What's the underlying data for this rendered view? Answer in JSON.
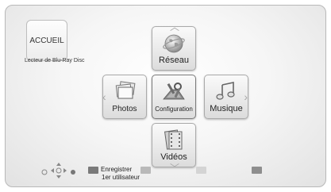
{
  "home": {
    "title": "ACCUEIL",
    "device_name": "Lecteur de Blu-Ray Disc"
  },
  "menu": {
    "items": [
      {
        "label": "Réseau",
        "icon": "globe-icon"
      },
      {
        "label": "Photos",
        "icon": "photos-icon"
      },
      {
        "label": "Configuration",
        "icon": "configuration-icon",
        "selected": true
      },
      {
        "label": "Musique",
        "icon": "music-notes-icon"
      },
      {
        "label": "Vidéos",
        "icon": "film-strip-icon"
      }
    ]
  },
  "footer": {
    "nav_icon": "dpad-navigation-icon",
    "red_label": "Enregistrer\n1er utilisateur",
    "red_line1": "Enregistrer",
    "red_line2": "1er utilisateur",
    "key_colors": {
      "red": "#7a7a7a",
      "green": "#b9b9b9",
      "yellow": "#d4d4d4",
      "blue": "#8e8e8e"
    }
  }
}
